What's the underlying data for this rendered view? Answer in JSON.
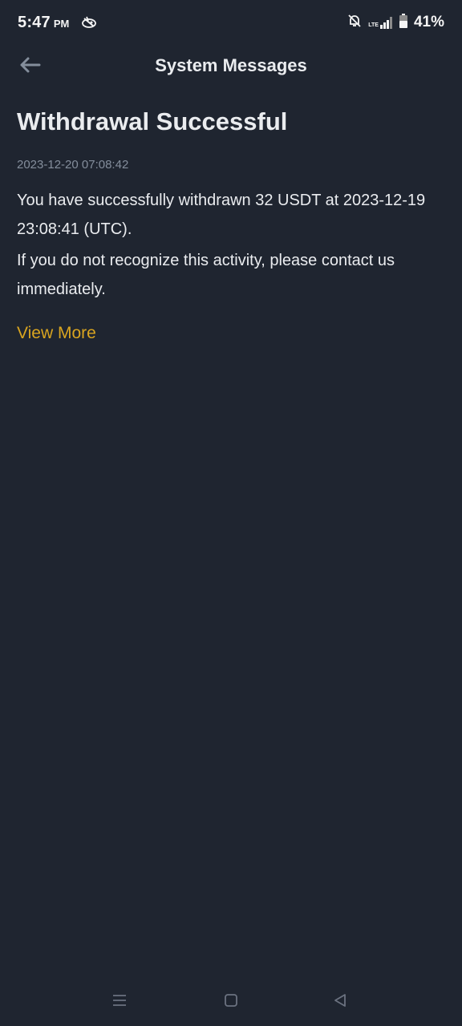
{
  "status_bar": {
    "time": "5:47",
    "ampm": "PM",
    "network_label": "LTE",
    "battery": "41%",
    "icons": [
      "app-notification-icon",
      "bell-off-icon",
      "signal-icon",
      "battery-icon"
    ]
  },
  "header": {
    "title": "System Messages",
    "back_icon": "arrow-left-icon"
  },
  "message": {
    "title": "Withdrawal Successful",
    "timestamp": "2023-12-20 07:08:42",
    "paragraph1": "You have successfully withdrawn 32 USDT at 2023-12-19 23:08:41 (UTC).",
    "paragraph2": "If you do not recognize this activity, please contact us immediately.",
    "view_more": "View More"
  },
  "nav_bar": {
    "icons": [
      "menu-icon",
      "home-icon",
      "back-icon"
    ]
  },
  "colors": {
    "background": "#1f2530",
    "text_primary": "#eaecef",
    "text_secondary": "#848e9c",
    "accent": "#d9a520"
  }
}
